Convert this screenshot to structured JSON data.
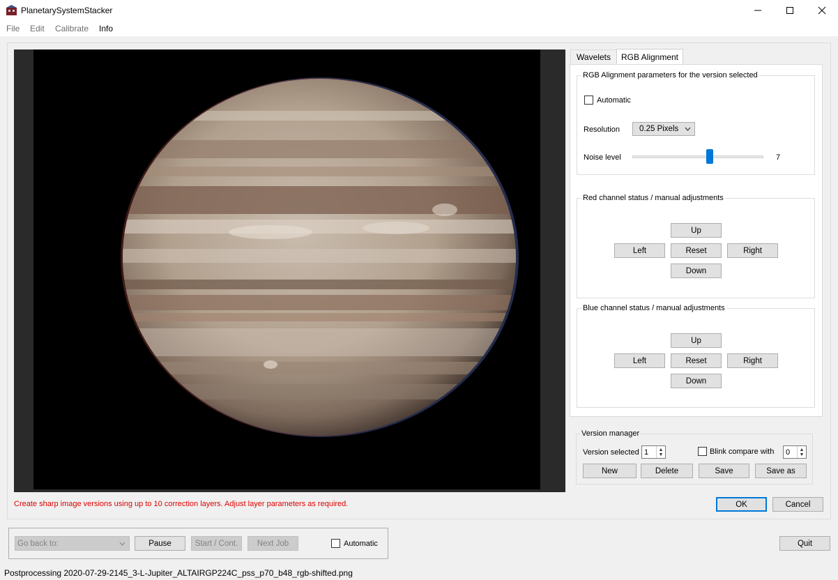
{
  "window": {
    "title": "PlanetarySystemStacker"
  },
  "menu": [
    "File",
    "Edit",
    "Calibrate",
    "Info"
  ],
  "tabs": {
    "wavelets": "Wavelets",
    "rgb_alignment": "RGB Alignment"
  },
  "rgb_params": {
    "group_title": "RGB Alignment parameters for the version selected",
    "automatic_label": "Automatic",
    "automatic_checked": false,
    "resolution_label": "Resolution",
    "resolution_value": "0.25 Pixels",
    "noise_label": "Noise level",
    "noise_value": "7",
    "noise_fraction": 0.59
  },
  "red_channel": {
    "title": "Red channel status / manual adjustments",
    "up": "Up",
    "left": "Left",
    "reset": "Reset",
    "right": "Right",
    "down": "Down"
  },
  "blue_channel": {
    "title": "Blue channel status / manual adjustments",
    "up": "Up",
    "left": "Left",
    "reset": "Reset",
    "right": "Right",
    "down": "Down"
  },
  "version_manager": {
    "title": "Version manager",
    "version_label": "Version selected",
    "version_value": "1",
    "blink_label": "Blink compare with",
    "blink_checked": false,
    "blink_value": "0",
    "new": "New",
    "delete": "Delete",
    "save": "Save",
    "save_as": "Save as"
  },
  "dialog": {
    "message": "Create sharp image versions using up to 10 correction layers. Adjust layer parameters as required.",
    "ok": "OK",
    "cancel": "Cancel"
  },
  "job_control": {
    "go_back_placeholder": "Go back to:",
    "pause": "Pause",
    "start": "Start / Cont.",
    "next_job": "Next Job",
    "automatic_label": "Automatic",
    "quit": "Quit"
  },
  "status_bar": "Postprocessing 2020-07-29-2145_3-L-Jupiter_ALTAIRGP224C_pss_p70_b48_rgb-shifted.png",
  "colors": {
    "accent": "#0078d7",
    "error": "#e00000"
  }
}
